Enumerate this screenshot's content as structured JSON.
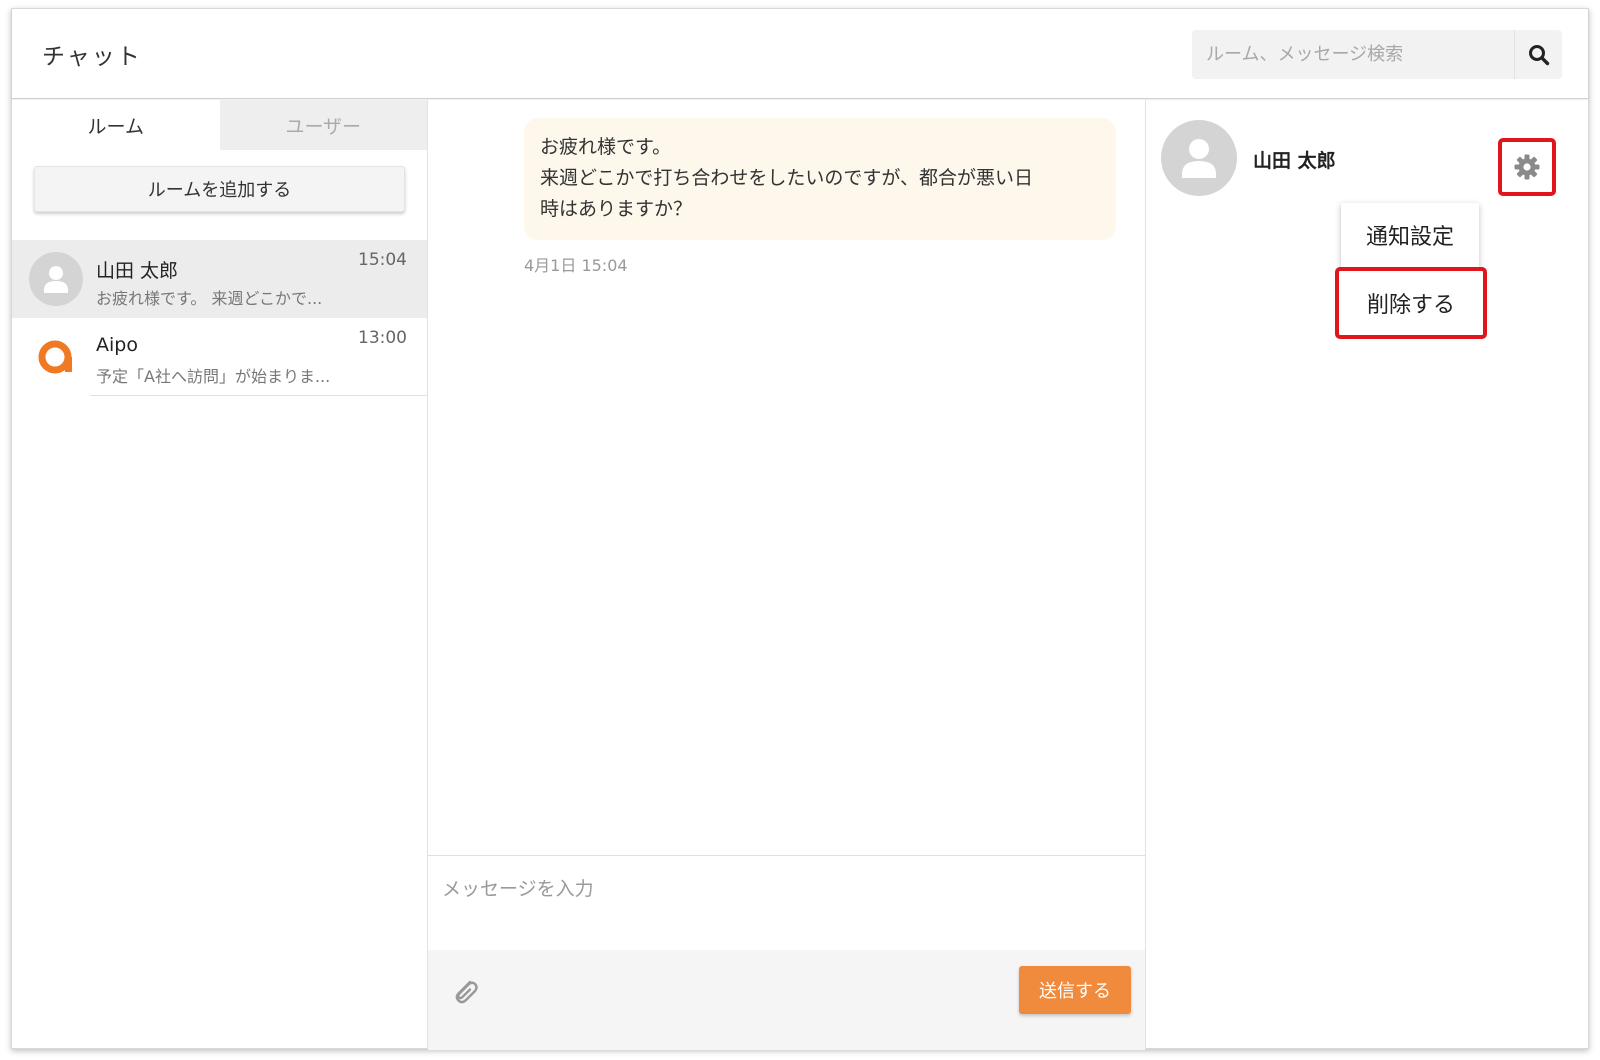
{
  "header": {
    "title": "チャット",
    "search_placeholder": "ルーム、メッセージ検索",
    "search_icon": "search-icon"
  },
  "left": {
    "tabs": [
      {
        "label": "ルーム",
        "active": true
      },
      {
        "label": "ユーザー",
        "active": false
      }
    ],
    "add_room_label": "ルームを追加する",
    "rooms": [
      {
        "name": "山田 太郎",
        "time": "15:04",
        "preview": "お疲れ様です。 来週どこかで...",
        "icon": "user-avatar-icon",
        "selected": true
      },
      {
        "name": "Aipo",
        "time": "13:00",
        "preview": "予定「A社へ訪問」が始まりま...",
        "icon": "aipo-logo-icon",
        "selected": false
      }
    ]
  },
  "chat": {
    "message_lines": [
      "お疲れ様です。",
      "来週どこかで打ち合わせをしたいのですが、都合が悪い日",
      "時はありますか？"
    ],
    "message_time": "4月1日 15:04",
    "input_placeholder": "メッセージを入力",
    "attach_icon": "paperclip-icon",
    "send_label": "送信する"
  },
  "room_info": {
    "user_name": "山田 太郎",
    "settings_icon": "gear-icon",
    "menu": {
      "notification_label": "通知設定",
      "delete_label": "削除する"
    }
  },
  "colors": {
    "accent": "#f08a3c",
    "highlight": "#e0161c",
    "bubble": "#fdf7ec",
    "avatar_gray": "#d4d4d4"
  }
}
